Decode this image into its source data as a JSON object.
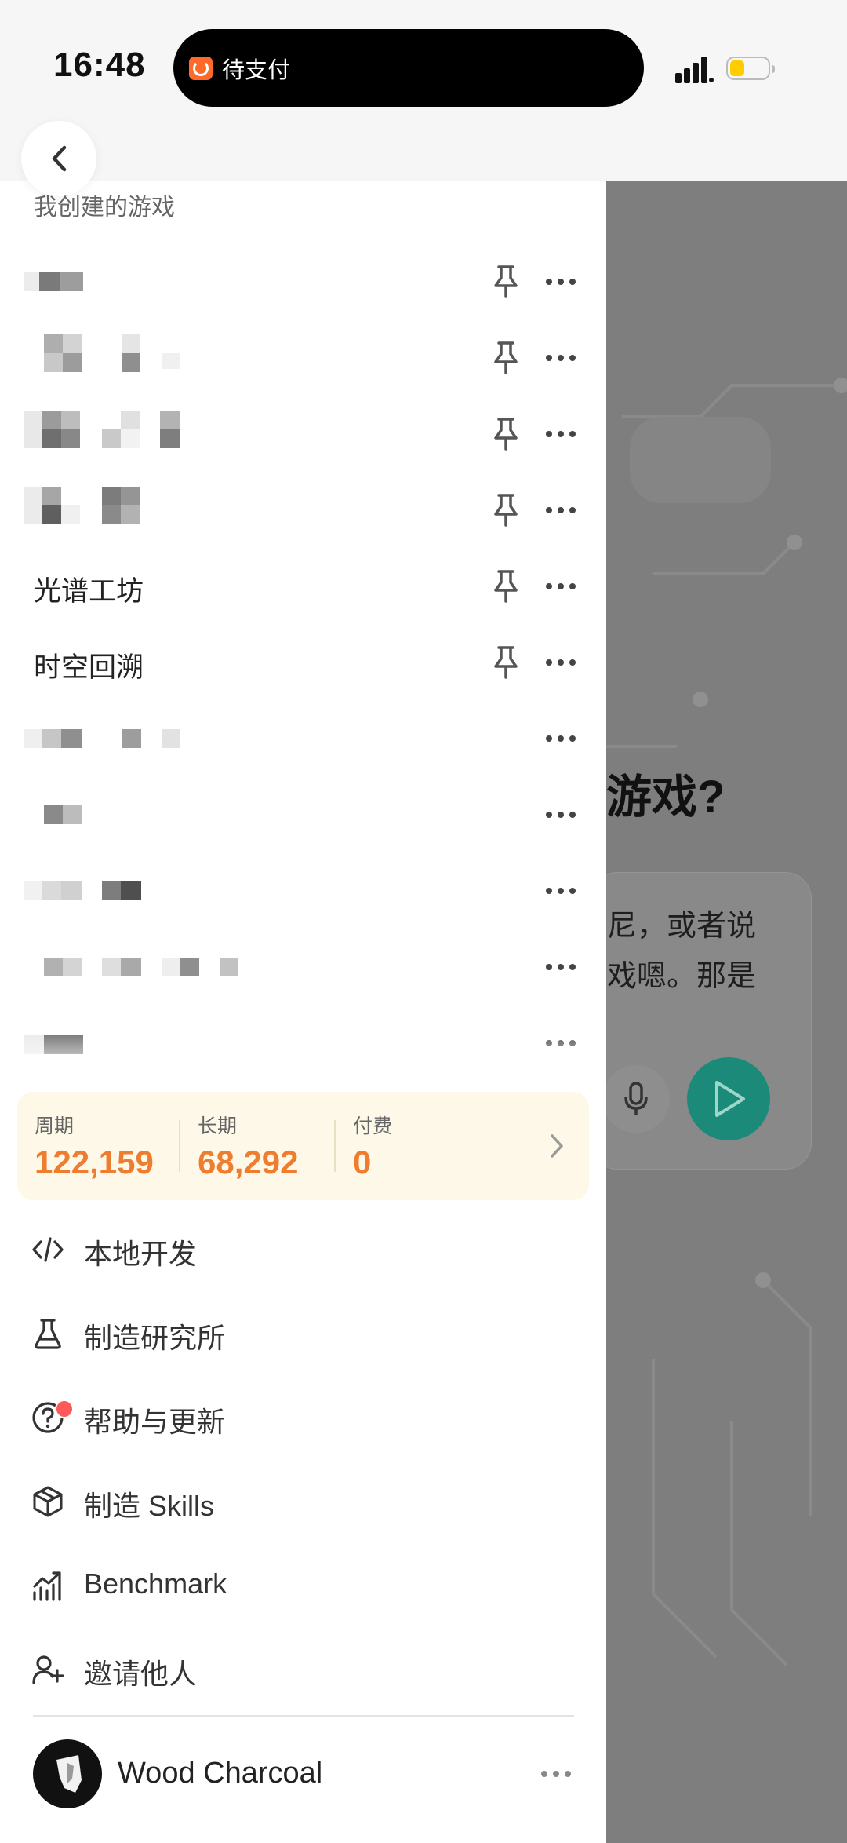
{
  "status_bar": {
    "time": "16:48",
    "live_activity_text": "待支付",
    "live_activity_color": "#ff6a2b",
    "battery_color": "#ffcc00"
  },
  "background": {
    "heading": "游戏?",
    "card_lines": "尼，或者说\n戏嗯。那是",
    "send_color": "#1c8a78"
  },
  "drawer": {
    "section_title": "我创建的游戏",
    "games": [
      {
        "name": "",
        "obscured": true,
        "pinned": true
      },
      {
        "name": "",
        "obscured": true,
        "pinned": true
      },
      {
        "name": "",
        "obscured": true,
        "pinned": true
      },
      {
        "name": "",
        "obscured": true,
        "pinned": true
      },
      {
        "name": "光谱工坊",
        "obscured": false,
        "pinned": true
      },
      {
        "name": "时空回溯",
        "obscured": false,
        "pinned": true
      },
      {
        "name": "",
        "obscured": true,
        "pinned": false
      },
      {
        "name": "",
        "obscured": true,
        "pinned": false
      },
      {
        "name": "",
        "obscured": true,
        "pinned": false
      },
      {
        "name": "",
        "obscured": true,
        "pinned": false
      },
      {
        "name": "",
        "obscured": true,
        "pinned": false
      }
    ],
    "stats": {
      "weekly_label": "周期",
      "weekly_value": "122,159",
      "longterm_label": "长期",
      "longterm_value": "68,292",
      "paid_label": "付费",
      "paid_value": "0",
      "value_color": "#ef7d2f"
    },
    "menu": [
      {
        "label": "本地开发",
        "icon": "code-icon"
      },
      {
        "label": "制造研究所",
        "icon": "flask-icon"
      },
      {
        "label": "帮助与更新",
        "icon": "help-icon",
        "badge": true
      },
      {
        "label": "制造 Skills",
        "icon": "cube-icon"
      },
      {
        "label": "Benchmark",
        "icon": "chart-icon"
      },
      {
        "label": "邀请他人",
        "icon": "add-user-icon"
      }
    ],
    "profile": {
      "name": "Wood Charcoal"
    }
  }
}
